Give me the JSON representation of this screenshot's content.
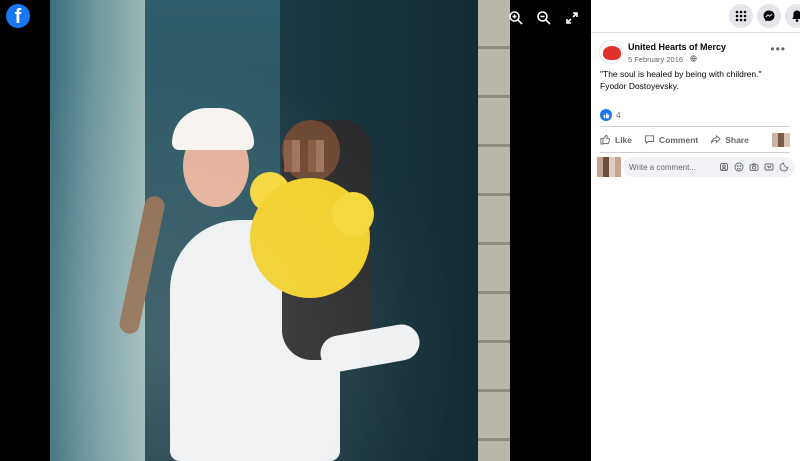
{
  "viewer": {
    "logo_letter": "f",
    "tools": [
      "zoom-in",
      "zoom-out",
      "fullscreen"
    ]
  },
  "topbar": {
    "buttons": [
      "menu-grid",
      "messenger",
      "notifications"
    ]
  },
  "post": {
    "author": "United Hearts of Mercy",
    "date": "5 February 2016 · ",
    "privacy_icon": "globe-icon",
    "text_line1": "\"The soul is healed by being with children.\"",
    "text_line2": "Fyodor Dostoyevsky.",
    "reaction_count": "4"
  },
  "actions": {
    "like": "Like",
    "comment": "Comment",
    "share": "Share"
  },
  "comment_input": {
    "placeholder": "Write a comment..."
  },
  "colors": {
    "brand": "#1877f2",
    "panel_bg": "#ffffff",
    "muted_text": "#65676b"
  }
}
